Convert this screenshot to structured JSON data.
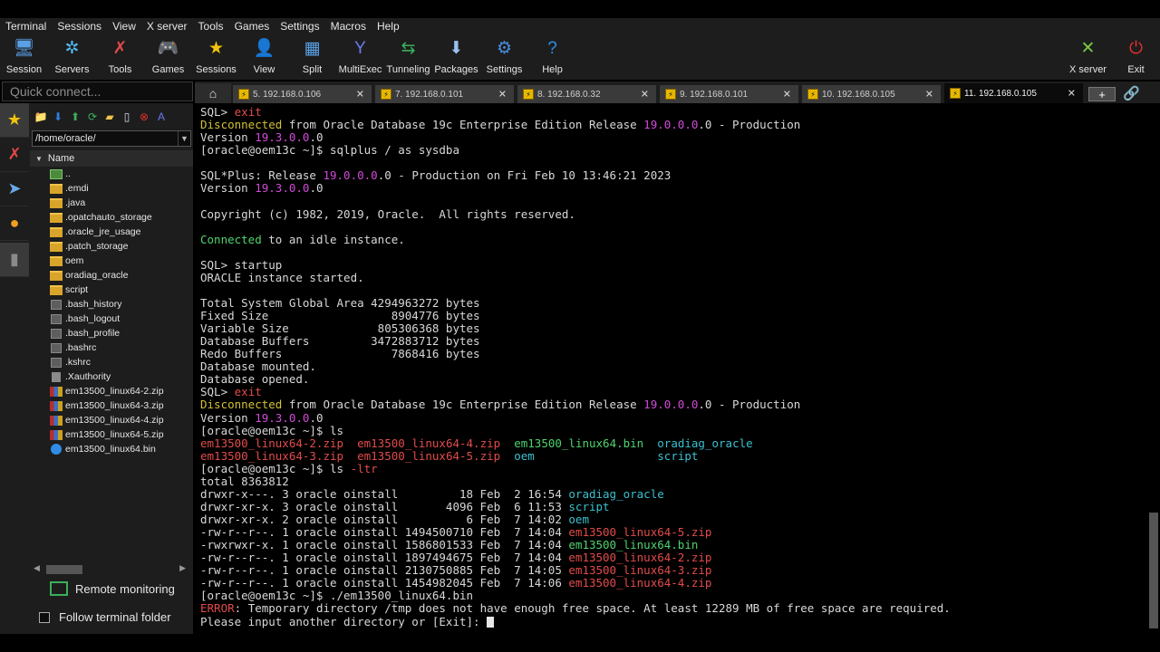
{
  "menubar": [
    "Terminal",
    "Sessions",
    "View",
    "X server",
    "Tools",
    "Games",
    "Settings",
    "Macros",
    "Help"
  ],
  "toolbar": {
    "left": [
      {
        "label": "Session",
        "icon": "session-monitor-icon",
        "glyph": "🖥",
        "color": "#5aa0e6"
      },
      {
        "label": "Servers",
        "icon": "servers-icon",
        "glyph": "✲",
        "color": "#55b8f0"
      },
      {
        "label": "Tools",
        "icon": "tools-icon",
        "glyph": "✗",
        "color": "#e24848"
      },
      {
        "label": "Games",
        "icon": "games-gamepad-icon",
        "glyph": "🎮",
        "color": "#d0d0d0"
      },
      {
        "label": "Sessions",
        "icon": "sessions-star-icon",
        "glyph": "★",
        "color": "#f2c20e"
      },
      {
        "label": "View",
        "icon": "view-icon",
        "glyph": "👤",
        "color": "#7ab8e8"
      },
      {
        "label": "Split",
        "icon": "split-icon",
        "glyph": "▦",
        "color": "#5aa0e6"
      },
      {
        "label": "MultiExec",
        "icon": "multiexec-icon",
        "glyph": "Y",
        "color": "#6a7af0"
      },
      {
        "label": "Tunneling",
        "icon": "tunneling-icon",
        "glyph": "⇆",
        "color": "#3ab05a"
      },
      {
        "label": "Packages",
        "icon": "packages-icon",
        "glyph": "⬇",
        "color": "#9ac0f0"
      },
      {
        "label": "Settings",
        "icon": "settings-gear-icon",
        "glyph": "⚙",
        "color": "#4a8de0"
      },
      {
        "label": "Help",
        "icon": "help-icon",
        "glyph": "?",
        "color": "#2f8de8"
      }
    ],
    "right": [
      {
        "label": "X server",
        "icon": "x-server-icon",
        "glyph": "✕",
        "color": "#7ac943"
      },
      {
        "label": "Exit",
        "icon": "exit-power-icon",
        "glyph": "⏻",
        "color": "#e23030"
      }
    ]
  },
  "quick_connect": {
    "placeholder": "Quick connect..."
  },
  "tabs": [
    {
      "label": "5. 192.168.0.106",
      "active": false
    },
    {
      "label": "7. 192.168.0.101",
      "active": false
    },
    {
      "label": "8. 192.168.0.32",
      "active": false
    },
    {
      "label": "9. 192.168.0.101",
      "active": false
    },
    {
      "label": "10. 192.168.0.105",
      "active": false
    },
    {
      "label": "11. 192.168.0.105",
      "active": true
    }
  ],
  "sidebar_tabs": [
    {
      "icon": "favorites-star-icon",
      "glyph": "★",
      "color": "#f2c20e",
      "active": true
    },
    {
      "icon": "tools-icon",
      "glyph": "✗",
      "color": "#e24848",
      "active": false
    },
    {
      "icon": "send-paper-plane-icon",
      "glyph": "➤",
      "color": "#6aa8e8",
      "active": false
    },
    {
      "icon": "macros-icon",
      "glyph": "●",
      "color": "#f0a020",
      "active": false
    },
    {
      "icon": "sftp-icon",
      "glyph": "▮",
      "color": "#8a8a8a",
      "active": true
    }
  ],
  "sftp": {
    "path": "/home/oracle/",
    "header": "Name",
    "files": [
      {
        "name": "..",
        "type": "up"
      },
      {
        "name": ".emdi",
        "type": "folder"
      },
      {
        "name": ".java",
        "type": "folder"
      },
      {
        "name": ".opatchauto_storage",
        "type": "folder"
      },
      {
        "name": ".oracle_jre_usage",
        "type": "folder"
      },
      {
        "name": ".patch_storage",
        "type": "folder"
      },
      {
        "name": "oem",
        "type": "folder"
      },
      {
        "name": "oradiag_oracle",
        "type": "folder"
      },
      {
        "name": "script",
        "type": "folder"
      },
      {
        "name": ".bash_history",
        "type": "file"
      },
      {
        "name": ".bash_logout",
        "type": "file"
      },
      {
        "name": ".bash_profile",
        "type": "file"
      },
      {
        "name": ".bashrc",
        "type": "file"
      },
      {
        "name": ".kshrc",
        "type": "file"
      },
      {
        "name": ".Xauthority",
        "type": "xfile"
      },
      {
        "name": "em13500_linux64-2.zip",
        "type": "zip"
      },
      {
        "name": "em13500_linux64-3.zip",
        "type": "zip"
      },
      {
        "name": "em13500_linux64-4.zip",
        "type": "zip"
      },
      {
        "name": "em13500_linux64-5.zip",
        "type": "zip"
      },
      {
        "name": "em13500_linux64.bin",
        "type": "bin"
      }
    ],
    "remote_monitoring": "Remote monitoring",
    "follow_terminal": "Follow terminal folder"
  },
  "terminal": {
    "lines": [
      [
        [
          "d",
          "SQL> "
        ],
        [
          "r",
          "exit"
        ]
      ],
      [
        [
          "y",
          "Disconnected"
        ],
        [
          "d",
          " from Oracle Database 19c Enterprise Edition Release "
        ],
        [
          "m",
          "19.0.0.0"
        ],
        [
          "d",
          ".0 - Production"
        ]
      ],
      [
        [
          "d",
          "Version "
        ],
        [
          "m",
          "19.3.0.0"
        ],
        [
          "d",
          ".0"
        ]
      ],
      [
        [
          "d",
          "[oracle@oem13c ~]$ sqlplus / as sysdba"
        ]
      ],
      [
        [
          "d",
          ""
        ]
      ],
      [
        [
          "d",
          "SQL*Plus: Release "
        ],
        [
          "m",
          "19.0.0.0"
        ],
        [
          "d",
          ".0 - Production on Fri Feb 10 13:46:21 2023"
        ]
      ],
      [
        [
          "d",
          "Version "
        ],
        [
          "m",
          "19.3.0.0"
        ],
        [
          "d",
          ".0"
        ]
      ],
      [
        [
          "d",
          ""
        ]
      ],
      [
        [
          "d",
          "Copyright (c) 1982, 2019, Oracle.  All rights reserved."
        ]
      ],
      [
        [
          "d",
          ""
        ]
      ],
      [
        [
          "g",
          "Connected"
        ],
        [
          "d",
          " to an idle instance."
        ]
      ],
      [
        [
          "d",
          ""
        ]
      ],
      [
        [
          "d",
          "SQL> startup"
        ]
      ],
      [
        [
          "d",
          "ORACLE instance started."
        ]
      ],
      [
        [
          "d",
          ""
        ]
      ],
      [
        [
          "d",
          "Total System Global Area 4294963272 bytes"
        ]
      ],
      [
        [
          "d",
          "Fixed Size                  8904776 bytes"
        ]
      ],
      [
        [
          "d",
          "Variable Size             805306368 bytes"
        ]
      ],
      [
        [
          "d",
          "Database Buffers         3472883712 bytes"
        ]
      ],
      [
        [
          "d",
          "Redo Buffers                7868416 bytes"
        ]
      ],
      [
        [
          "d",
          "Database mounted."
        ]
      ],
      [
        [
          "d",
          "Database opened."
        ]
      ],
      [
        [
          "d",
          "SQL> "
        ],
        [
          "r",
          "exit"
        ]
      ],
      [
        [
          "y",
          "Disconnected"
        ],
        [
          "d",
          " from Oracle Database 19c Enterprise Edition Release "
        ],
        [
          "m",
          "19.0.0.0"
        ],
        [
          "d",
          ".0 - Production"
        ]
      ],
      [
        [
          "d",
          "Version "
        ],
        [
          "m",
          "19.3.0.0"
        ],
        [
          "d",
          ".0"
        ]
      ],
      [
        [
          "d",
          "[oracle@oem13c ~]$ ls"
        ]
      ],
      [
        [
          "r",
          "em13500_linux64-2.zip"
        ],
        [
          "d",
          "  "
        ],
        [
          "r",
          "em13500_linux64-4.zip"
        ],
        [
          "d",
          "  "
        ],
        [
          "g",
          "em13500_linux64.bin"
        ],
        [
          "d",
          "  "
        ],
        [
          "c",
          "oradiag_oracle"
        ]
      ],
      [
        [
          "r",
          "em13500_linux64-3.zip"
        ],
        [
          "d",
          "  "
        ],
        [
          "r",
          "em13500_linux64-5.zip"
        ],
        [
          "d",
          "  "
        ],
        [
          "c",
          "oem"
        ],
        [
          "d",
          "                  "
        ],
        [
          "c",
          "script"
        ]
      ],
      [
        [
          "d",
          "[oracle@oem13c ~]$ ls "
        ],
        [
          "r",
          "-ltr"
        ]
      ],
      [
        [
          "d",
          "total 8363812"
        ]
      ],
      [
        [
          "d",
          "drwxr-x---. 3 oracle oinstall         18 Feb  2 16:54 "
        ],
        [
          "c",
          "oradiag_oracle"
        ]
      ],
      [
        [
          "d",
          "drwxr-xr-x. 3 oracle oinstall       4096 Feb  6 11:53 "
        ],
        [
          "c",
          "script"
        ]
      ],
      [
        [
          "d",
          "drwxr-xr-x. 2 oracle oinstall          6 Feb  7 14:02 "
        ],
        [
          "c",
          "oem"
        ]
      ],
      [
        [
          "d",
          "-rw-r--r--. 1 oracle oinstall 1494500710 Feb  7 14:04 "
        ],
        [
          "r",
          "em13500_linux64-5.zip"
        ]
      ],
      [
        [
          "d",
          "-rwxrwxr-x. 1 oracle oinstall 1586801533 Feb  7 14:04 "
        ],
        [
          "g",
          "em13500_linux64.bin"
        ]
      ],
      [
        [
          "d",
          "-rw-r--r--. 1 oracle oinstall 1897494675 Feb  7 14:04 "
        ],
        [
          "r",
          "em13500_linux64-2.zip"
        ]
      ],
      [
        [
          "d",
          "-rw-r--r--. 1 oracle oinstall 2130750885 Feb  7 14:05 "
        ],
        [
          "r",
          "em13500_linux64-3.zip"
        ]
      ],
      [
        [
          "d",
          "-rw-r--r--. 1 oracle oinstall 1454982045 Feb  7 14:06 "
        ],
        [
          "r",
          "em13500_linux64-4.zip"
        ]
      ],
      [
        [
          "d",
          "[oracle@oem13c ~]$ ./em13500_linux64.bin"
        ]
      ],
      [
        [
          "r",
          "ERROR"
        ],
        [
          "d",
          ": Temporary directory /tmp does not have enough free space. At least 12289 MB of free space are required."
        ]
      ],
      [
        [
          "d",
          "Please input another directory or [Exit]: "
        ]
      ]
    ]
  },
  "colors": {
    "accent_yellow": "#d2c235",
    "error_red": "#e24b4b",
    "magenta": "#d14ad8",
    "green": "#4fd36d",
    "cyan": "#3ac0cf"
  }
}
